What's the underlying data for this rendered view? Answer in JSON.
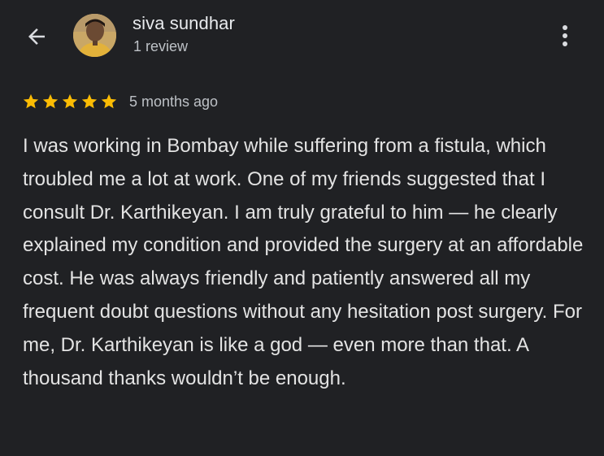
{
  "header": {
    "back_icon": "arrow-back-icon",
    "reviewer_name": "siva sundhar",
    "review_count": "1 review",
    "more_icon": "more-vert-icon"
  },
  "review": {
    "rating": 5,
    "max_rating": 5,
    "star_color": "#fbbc04",
    "time": "5 months ago",
    "text": "I was working in Bombay while suffering from a fistula, which troubled me a lot at work. One of my friends suggested that I consult Dr. Karthikeyan. I am truly grateful to him — he clearly explained my condition and provided the surgery at an affordable cost. He was always friendly and patiently answered all my frequent doubt questions without any hesitation post surgery. For me, Dr. Karthikeyan is like a god — even more than that. A thousand thanks wouldn’t be enough."
  }
}
